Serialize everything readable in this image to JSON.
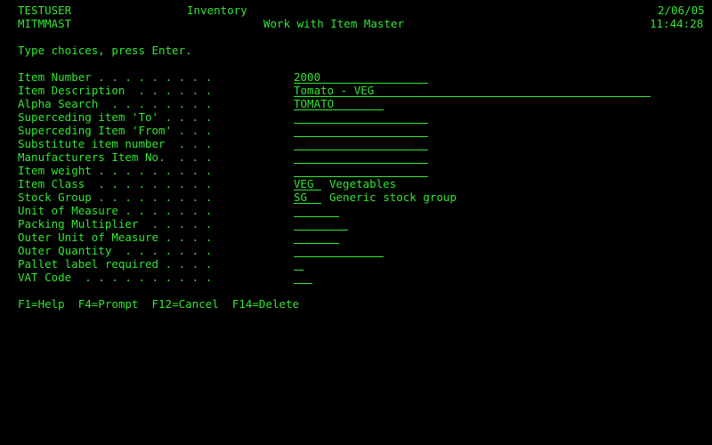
{
  "header": {
    "user": "TESTUSER",
    "program": "MITMMAST",
    "app_title": "Inventory",
    "screen_title": "Work with Item Master",
    "date": "2/06/05",
    "time": "11:44:28"
  },
  "instruction": "Type choices, press Enter.",
  "fields": [
    {
      "label": "Item Number . . . . . . . . .",
      "value": "2000"
    },
    {
      "label": "Item Description  . . . . . .",
      "value": "Tomato - VEG"
    },
    {
      "label": "Alpha Search  . . . . . . . .",
      "value": "TOMATO"
    },
    {
      "label": "Superceding item 'To' . . . .",
      "value": ""
    },
    {
      "label": "Superceding Item 'From' . . .",
      "value": ""
    },
    {
      "label": "Substitute item number  . . .",
      "value": ""
    },
    {
      "label": "Manufacturers Item No.  . . .",
      "value": ""
    },
    {
      "label": "Item weight . . . . . . . . .",
      "value": ""
    },
    {
      "label": "Item Class  . . . . . . . . .",
      "value": "VEG",
      "desc": "Vegetables"
    },
    {
      "label": "Stock Group . . . . . . . . .",
      "value": "SG",
      "desc": "Generic stock group"
    },
    {
      "label": "Unit of Measure . . . . . . .",
      "value": ""
    },
    {
      "label": "Packing Multiplier  . . . . .",
      "value": ""
    },
    {
      "label": "Outer Unit of Measure . . . .",
      "value": ""
    },
    {
      "label": "Outer Quantity  . . . . . . .",
      "value": ""
    },
    {
      "label": "Pallet label required . . . .",
      "value": ""
    },
    {
      "label": "VAT Code  . . . . . . . . . .",
      "value": ""
    }
  ],
  "function_keys": "F1=Help  F4=Prompt  F12=Cancel  F14=Delete",
  "colors": {
    "background": "#000000",
    "text": "#33e533"
  }
}
